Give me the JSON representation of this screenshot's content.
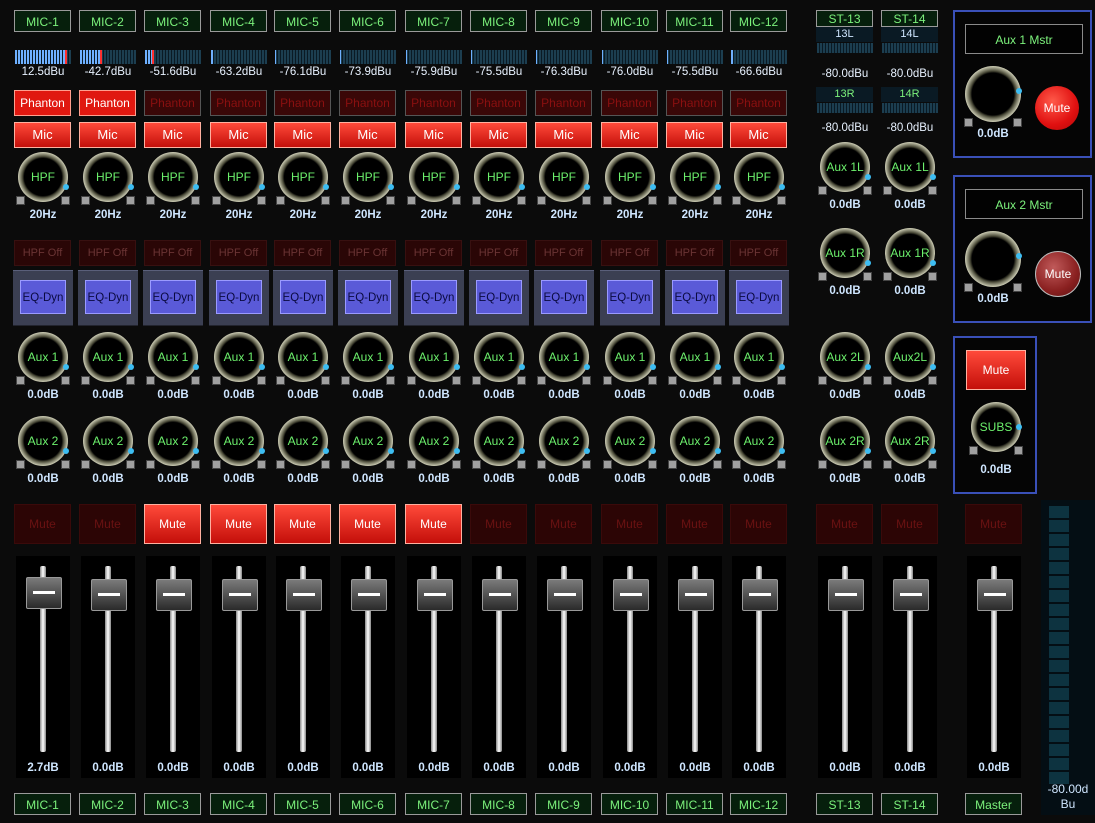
{
  "mic_channels": [
    {
      "name": "MIC-1",
      "level": "12.5dBu",
      "level_frac": 0.9,
      "phantom": "Phanton",
      "phantom_on": true,
      "mic": "Mic",
      "hpf": "HPF",
      "hpf_freq": "20Hz",
      "hpf_off": "HPF Off",
      "eq": "EQ-Dyn",
      "aux1": "Aux 1",
      "aux1_val": "0.0dB",
      "aux2": "Aux 2",
      "aux2_val": "0.0dB",
      "mute": "Mute",
      "mute_on": false,
      "fader_val": "2.7dB",
      "fader_frac": 0.97,
      "bottom": "MIC-1"
    },
    {
      "name": "MIC-2",
      "level": "-42.7dBu",
      "level_frac": 0.35,
      "phantom": "Phanton",
      "phantom_on": true,
      "mic": "Mic",
      "hpf": "HPF",
      "hpf_freq": "20Hz",
      "hpf_off": "HPF Off",
      "eq": "EQ-Dyn",
      "aux1": "Aux 1",
      "aux1_val": "0.0dB",
      "aux2": "Aux 2",
      "aux2_val": "0.0dB",
      "mute": "Mute",
      "mute_on": false,
      "fader_val": "0.0dB",
      "fader_frac": 0.92,
      "bottom": "MIC-2"
    },
    {
      "name": "MIC-3",
      "level": "-51.6dBu",
      "level_frac": 0.12,
      "phantom": "Phanton",
      "phantom_on": false,
      "mic": "Mic",
      "hpf": "HPF",
      "hpf_freq": "20Hz",
      "hpf_off": "HPF Off",
      "eq": "EQ-Dyn",
      "aux1": "Aux 1",
      "aux1_val": "0.0dB",
      "aux2": "Aux 2",
      "aux2_val": "0.0dB",
      "mute": "Mute",
      "mute_on": true,
      "fader_val": "0.0dB",
      "fader_frac": 0.92,
      "bottom": "MIC-3"
    },
    {
      "name": "MIC-4",
      "level": "-63.2dBu",
      "level_frac": 0.05,
      "phantom": "Phanton",
      "phantom_on": false,
      "mic": "Mic",
      "hpf": "HPF",
      "hpf_freq": "20Hz",
      "hpf_off": "HPF Off",
      "eq": "EQ-Dyn",
      "aux1": "Aux 1",
      "aux1_val": "0.0dB",
      "aux2": "Aux 2",
      "aux2_val": "0.0dB",
      "mute": "Mute",
      "mute_on": true,
      "fader_val": "0.0dB",
      "fader_frac": 0.92,
      "bottom": "MIC-4"
    },
    {
      "name": "MIC-5",
      "level": "-76.1dBu",
      "level_frac": 0.02,
      "phantom": "Phanton",
      "phantom_on": false,
      "mic": "Mic",
      "hpf": "HPF",
      "hpf_freq": "20Hz",
      "hpf_off": "HPF Off",
      "eq": "EQ-Dyn",
      "aux1": "Aux 1",
      "aux1_val": "0.0dB",
      "aux2": "Aux 2",
      "aux2_val": "0.0dB",
      "mute": "Mute",
      "mute_on": true,
      "fader_val": "0.0dB",
      "fader_frac": 0.92,
      "bottom": "MIC-5"
    },
    {
      "name": "MIC-6",
      "level": "-73.9dBu",
      "level_frac": 0.02,
      "phantom": "Phanton",
      "phantom_on": false,
      "mic": "Mic",
      "hpf": "HPF",
      "hpf_freq": "20Hz",
      "hpf_off": "HPF Off",
      "eq": "EQ-Dyn",
      "aux1": "Aux 1",
      "aux1_val": "0.0dB",
      "aux2": "Aux 2",
      "aux2_val": "0.0dB",
      "mute": "Mute",
      "mute_on": true,
      "fader_val": "0.0dB",
      "fader_frac": 0.92,
      "bottom": "MIC-6"
    },
    {
      "name": "MIC-7",
      "level": "-75.9dBu",
      "level_frac": 0.02,
      "phantom": "Phanton",
      "phantom_on": false,
      "mic": "Mic",
      "hpf": "HPF",
      "hpf_freq": "20Hz",
      "hpf_off": "HPF Off",
      "eq": "EQ-Dyn",
      "aux1": "Aux 1",
      "aux1_val": "0.0dB",
      "aux2": "Aux 2",
      "aux2_val": "0.0dB",
      "mute": "Mute",
      "mute_on": true,
      "fader_val": "0.0dB",
      "fader_frac": 0.92,
      "bottom": "MIC-7"
    },
    {
      "name": "MIC-8",
      "level": "-75.5dBu",
      "level_frac": 0.02,
      "phantom": "Phanton",
      "phantom_on": false,
      "mic": "Mic",
      "hpf": "HPF",
      "hpf_freq": "20Hz",
      "hpf_off": "HPF Off",
      "eq": "EQ-Dyn",
      "aux1": "Aux 1",
      "aux1_val": "0.0dB",
      "aux2": "Aux 2",
      "aux2_val": "0.0dB",
      "mute": "Mute",
      "mute_on": false,
      "fader_val": "0.0dB",
      "fader_frac": 0.92,
      "bottom": "MIC-8"
    },
    {
      "name": "MIC-9",
      "level": "-76.3dBu",
      "level_frac": 0.02,
      "phantom": "Phanton",
      "phantom_on": false,
      "mic": "Mic",
      "hpf": "HPF",
      "hpf_freq": "20Hz",
      "hpf_off": "HPF Off",
      "eq": "EQ-Dyn",
      "aux1": "Aux 1",
      "aux1_val": "0.0dB",
      "aux2": "Aux 2",
      "aux2_val": "0.0dB",
      "mute": "Mute",
      "mute_on": false,
      "fader_val": "0.0dB",
      "fader_frac": 0.92,
      "bottom": "MIC-9"
    },
    {
      "name": "MIC-10",
      "level": "-76.0dBu",
      "level_frac": 0.02,
      "phantom": "Phanton",
      "phantom_on": false,
      "mic": "Mic",
      "hpf": "HPF",
      "hpf_freq": "20Hz",
      "hpf_off": "HPF Off",
      "eq": "EQ-Dyn",
      "aux1": "Aux 1",
      "aux1_val": "0.0dB",
      "aux2": "Aux 2",
      "aux2_val": "0.0dB",
      "mute": "Mute",
      "mute_on": false,
      "fader_val": "0.0dB",
      "fader_frac": 0.92,
      "bottom": "MIC-10"
    },
    {
      "name": "MIC-11",
      "level": "-75.5dBu",
      "level_frac": 0.02,
      "phantom": "Phanton",
      "phantom_on": false,
      "mic": "Mic",
      "hpf": "HPF",
      "hpf_freq": "20Hz",
      "hpf_off": "HPF Off",
      "eq": "EQ-Dyn",
      "aux1": "Aux 1",
      "aux1_val": "0.0dB",
      "aux2": "Aux 2",
      "aux2_val": "0.0dB",
      "mute": "Mute",
      "mute_on": false,
      "fader_val": "0.0dB",
      "fader_frac": 0.92,
      "bottom": "MIC-11"
    },
    {
      "name": "MIC-12",
      "level": "-66.6dBu",
      "level_frac": 0.04,
      "phantom": "Phanton",
      "phantom_on": false,
      "mic": "Mic",
      "hpf": "HPF",
      "hpf_freq": "20Hz",
      "hpf_off": "HPF Off",
      "eq": "EQ-Dyn",
      "aux1": "Aux 1",
      "aux1_val": "0.0dB",
      "aux2": "Aux  2",
      "aux2_val": "0.0dB",
      "mute": "Mute",
      "mute_on": false,
      "fader_val": "0.0dB",
      "fader_frac": 0.92,
      "bottom": "MIC-12"
    }
  ],
  "stereo_channels": [
    {
      "name": "ST-13",
      "meter_a_label": "13L",
      "meter_a_val": "-80.0dBu",
      "meter_b_label": "13R",
      "meter_b_val": "-80.0dBu",
      "aux1l": "Aux 1L",
      "aux1l_val": "0.0dB",
      "aux1r": "Aux 1R",
      "aux1r_val": "0.0dB",
      "aux2l": "Aux 2L",
      "aux2l_val": "0.0dB",
      "aux2r": "Aux 2R",
      "aux2r_val": "0.0dB",
      "mute": "Mute",
      "mute_on": false,
      "fader_val": "0.0dB",
      "fader_frac": 0.92,
      "bottom": "ST-13"
    },
    {
      "name": "ST-14",
      "meter_a_label": "14L",
      "meter_a_val": "-80.0dBu",
      "meter_b_label": "14R",
      "meter_b_val": "-80.0dBu",
      "aux1l": "Aux 1L",
      "aux1l_val": "0.0dB",
      "aux1r": "Aux 1R",
      "aux1r_val": "0.0dB",
      "aux2l": "Aux2L",
      "aux2l_val": "0.0dB",
      "aux2r": "Aux 2R",
      "aux2r_val": "0.0dB",
      "mute": "Mute",
      "mute_on": false,
      "fader_val": "0.0dB",
      "fader_frac": 0.92,
      "bottom": "ST-14"
    }
  ],
  "aux1_master": {
    "label": "Aux 1 Mstr",
    "value": "0.0dB",
    "mute": "Mute",
    "mute_on": true
  },
  "aux2_master": {
    "label": "Aux 2 Mstr",
    "value": "0.0dB",
    "mute": "Mute",
    "mute_on": false
  },
  "subs": {
    "mute": "Mute",
    "mute_on": true,
    "knob": "SUBS",
    "value": "0.0dB"
  },
  "master": {
    "mute": "Mute",
    "mute_on": false,
    "fader_val": "0.0dB",
    "fader_frac": 0.92,
    "bottom": "Master"
  },
  "master_meter": {
    "value": "-80.00dBu",
    "line1": "-80.00d",
    "line2": "Bu"
  },
  "colors": {
    "label_green": "#7cf27c",
    "mute_red": "#e01810",
    "eq_blue": "#5a5ad8",
    "panel_border": "#3a50b8",
    "accent_dot": "#3dbdf2"
  }
}
